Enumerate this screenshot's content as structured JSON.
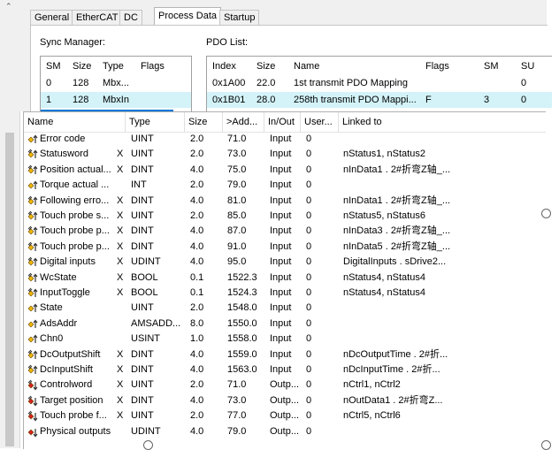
{
  "tabs": [
    "General",
    "EtherCAT",
    "DC",
    "Process Data",
    "Startup"
  ],
  "active_tab": "Process Data",
  "sync_manager": {
    "label": "Sync Manager:",
    "columns": [
      "SM",
      "Size",
      "Type",
      "Flags"
    ],
    "rows": [
      {
        "sm": "0",
        "size": "128",
        "type": "Mbx...",
        "flags": ""
      },
      {
        "sm": "1",
        "size": "128",
        "type": "MbxIn",
        "flags": ""
      }
    ],
    "selected_row": 1
  },
  "pdo_list": {
    "label": "PDO List:",
    "columns": [
      "Index",
      "Size",
      "Name",
      "Flags",
      "SM",
      "SU"
    ],
    "rows": [
      {
        "index": "0x1A00",
        "size": "22.0",
        "name": "1st transmit PDO Mapping",
        "flags": "",
        "sm": "",
        "su": "0"
      },
      {
        "index": "0x1B01",
        "size": "28.0",
        "name": "258th transmit PDO Mappi...",
        "flags": "F",
        "sm": "3",
        "su": "0"
      }
    ],
    "selected_row": 1
  },
  "variables": {
    "columns": [
      "Name",
      "Type",
      "Size",
      ">Add...",
      "In/Out",
      "User...",
      "Linked to"
    ],
    "rows": [
      {
        "icon": "input-var-icon",
        "name": "Error code",
        "x": "",
        "type": "UINT",
        "size": "2.0",
        "addr": "71.0",
        "inout": "Input",
        "user": "0",
        "linked": ""
      },
      {
        "icon": "linked-input-var-icon",
        "name": "Statusword",
        "x": "X",
        "type": "UINT",
        "size": "2.0",
        "addr": "73.0",
        "inout": "Input",
        "user": "0",
        "linked": "nStatus1, nStatus2"
      },
      {
        "icon": "linked-input-var-icon",
        "name": "Position actual...",
        "x": "X",
        "type": "DINT",
        "size": "4.0",
        "addr": "75.0",
        "inout": "Input",
        "user": "0",
        "linked": "nInData1 . 2#折弯Z轴_..."
      },
      {
        "icon": "input-var-icon",
        "name": "Torque actual ...",
        "x": "",
        "type": "INT",
        "size": "2.0",
        "addr": "79.0",
        "inout": "Input",
        "user": "0",
        "linked": ""
      },
      {
        "icon": "linked-input-var-icon",
        "name": "Following erro...",
        "x": "X",
        "type": "DINT",
        "size": "4.0",
        "addr": "81.0",
        "inout": "Input",
        "user": "0",
        "linked": "nInData1 . 2#折弯Z轴_..."
      },
      {
        "icon": "linked-input-var-icon",
        "name": "Touch probe s...",
        "x": "X",
        "type": "UINT",
        "size": "2.0",
        "addr": "85.0",
        "inout": "Input",
        "user": "0",
        "linked": "nStatus5, nStatus6"
      },
      {
        "icon": "linked-input-var-icon",
        "name": "Touch probe p...",
        "x": "X",
        "type": "DINT",
        "size": "4.0",
        "addr": "87.0",
        "inout": "Input",
        "user": "0",
        "linked": "nInData3 . 2#折弯Z轴_..."
      },
      {
        "icon": "linked-input-var-icon",
        "name": "Touch probe p...",
        "x": "X",
        "type": "DINT",
        "size": "4.0",
        "addr": "91.0",
        "inout": "Input",
        "user": "0",
        "linked": "nInData5 . 2#折弯Z轴_..."
      },
      {
        "icon": "linked-input-var-icon",
        "name": "Digital inputs",
        "x": "X",
        "type": "UDINT",
        "size": "4.0",
        "addr": "95.0",
        "inout": "Input",
        "user": "0",
        "linked": "DigitalInputs . sDrive2..."
      },
      {
        "icon": "linked-input-var-icon",
        "name": "WcState",
        "x": "X",
        "type": "BOOL",
        "size": "0.1",
        "addr": "1522.3",
        "inout": "Input",
        "user": "0",
        "linked": "nStatus4, nStatus4"
      },
      {
        "icon": "linked-input-var-icon",
        "name": "InputToggle",
        "x": "X",
        "type": "BOOL",
        "size": "0.1",
        "addr": "1524.3",
        "inout": "Input",
        "user": "0",
        "linked": "nStatus4, nStatus4"
      },
      {
        "icon": "input-var-icon",
        "name": "State",
        "x": "",
        "type": "UINT",
        "size": "2.0",
        "addr": "1548.0",
        "inout": "Input",
        "user": "0",
        "linked": ""
      },
      {
        "icon": "input-var-icon",
        "name": "AdsAddr",
        "x": "",
        "type": "AMSADD...",
        "size": "8.0",
        "addr": "1550.0",
        "inout": "Input",
        "user": "0",
        "linked": ""
      },
      {
        "icon": "input-var-icon",
        "name": "Chn0",
        "x": "",
        "type": "USINT",
        "size": "1.0",
        "addr": "1558.0",
        "inout": "Input",
        "user": "0",
        "linked": ""
      },
      {
        "icon": "linked-input-var-icon",
        "name": "DcOutputShift",
        "x": "X",
        "type": "DINT",
        "size": "4.0",
        "addr": "1559.0",
        "inout": "Input",
        "user": "0",
        "linked": "nDcOutputTime . 2#折..."
      },
      {
        "icon": "linked-input-var-icon",
        "name": "DcInputShift",
        "x": "X",
        "type": "DINT",
        "size": "4.0",
        "addr": "1563.0",
        "inout": "Input",
        "user": "0",
        "linked": "nDcInputTime . 2#折..."
      },
      {
        "icon": "linked-output-var-icon",
        "name": "Controlword",
        "x": "X",
        "type": "UINT",
        "size": "2.0",
        "addr": "71.0",
        "inout": "Outp...",
        "user": "0",
        "linked": "nCtrl1, nCtrl2"
      },
      {
        "icon": "linked-output-var-icon",
        "name": "Target position",
        "x": "X",
        "type": "DINT",
        "size": "4.0",
        "addr": "73.0",
        "inout": "Outp...",
        "user": "0",
        "linked": "nOutData1 . 2#折弯Z..."
      },
      {
        "icon": "linked-output-var-icon",
        "name": "Touch probe f...",
        "x": "X",
        "type": "UINT",
        "size": "2.0",
        "addr": "77.0",
        "inout": "Outp...",
        "user": "0",
        "linked": "nCtrl5, nCtrl6"
      },
      {
        "icon": "output-var-icon",
        "name": "Physical outputs",
        "x": "",
        "type": "UDINT",
        "size": "4.0",
        "addr": "79.0",
        "inout": "Outp...",
        "user": "0",
        "linked": ""
      }
    ]
  },
  "colors": {
    "selection": "#d3f3f8",
    "accent": "#0078d7",
    "icon_yellow": "#f2b705",
    "icon_red": "#d81e1e",
    "tab_border": "#c5c5c5"
  }
}
